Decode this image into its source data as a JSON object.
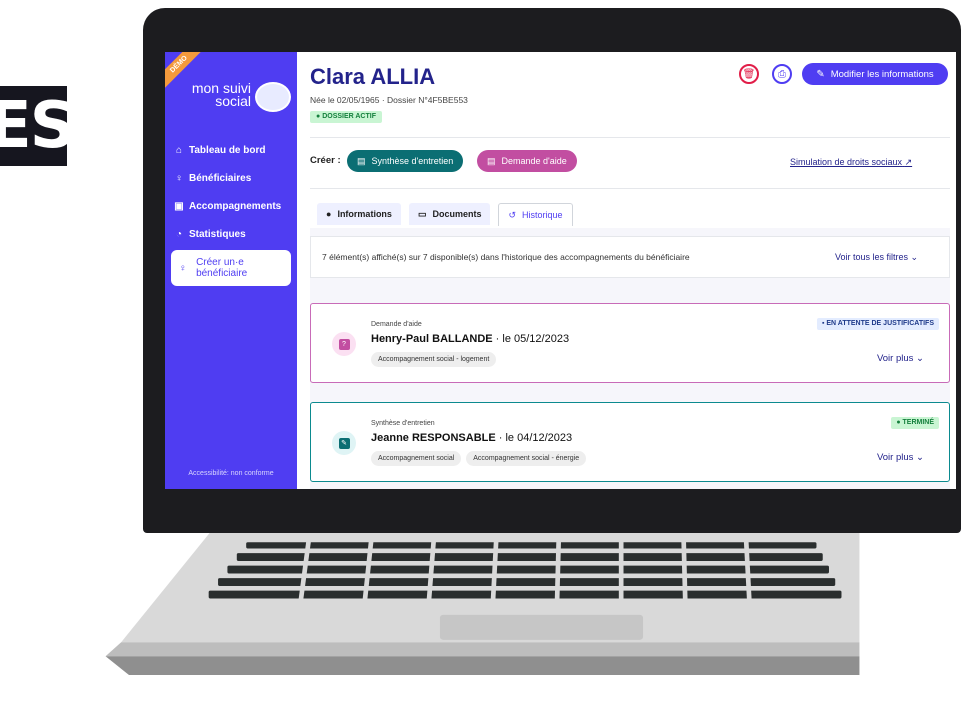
{
  "background": {
    "letters": "ES"
  },
  "sidebar": {
    "demo_ribbon": "DÉMO",
    "logo": "mon suivi social",
    "items": [
      {
        "label": "Tableau de bord",
        "icon": "home-icon"
      },
      {
        "label": "Bénéficiaires",
        "icon": "user-icon"
      },
      {
        "label": "Accompagnements",
        "icon": "calendar-icon"
      },
      {
        "label": "Statistiques",
        "icon": "pie-chart-icon"
      }
    ],
    "create_button": "Créer un·e bénéficiaire",
    "accessibility": "Accessibilité: non conforme"
  },
  "header": {
    "name": "Clara ALLIA",
    "meta": "Née le 02/05/1965 · Dossier N°4F5BE553",
    "status_badge": "DOSSIER ACTIF",
    "edit_button": "Modifier les informations"
  },
  "create_bar": {
    "label": "Créer :",
    "buttons": [
      "Synthèse d'entretien",
      "Demande d'aide"
    ],
    "simulation_link": "Simulation de droits sociaux"
  },
  "tabs": [
    {
      "label": "Informations"
    },
    {
      "label": "Documents"
    },
    {
      "label": "Historique",
      "active": true
    }
  ],
  "history": {
    "summary": "7 élément(s) affiché(s) sur 7 disponible(s) dans l'historique des accompagnements du bénéficiaire",
    "filters_link": "Voir tous les filtres",
    "items": [
      {
        "type": "Demande d'aide",
        "person": "Henry-Paul BALLANDE",
        "date": " · le 05/12/2023",
        "tags": [
          "Accompagnement social - logement"
        ],
        "status": "EN ATTENTE DE JUSTIFICATIFS",
        "more": "Voir plus"
      },
      {
        "type": "Synthèse d'entretien",
        "person": "Jeanne RESPONSABLE",
        "date": " · le 04/12/2023",
        "tags": [
          "Accompagnement social",
          "Accompagnement social - énergie"
        ],
        "status": "TERMINÉ",
        "more": "Voir plus"
      }
    ]
  },
  "colors": {
    "primary": "#4f3df2",
    "teal": "#0b6e73",
    "pink": "#c24ea1",
    "title": "#23238b"
  }
}
